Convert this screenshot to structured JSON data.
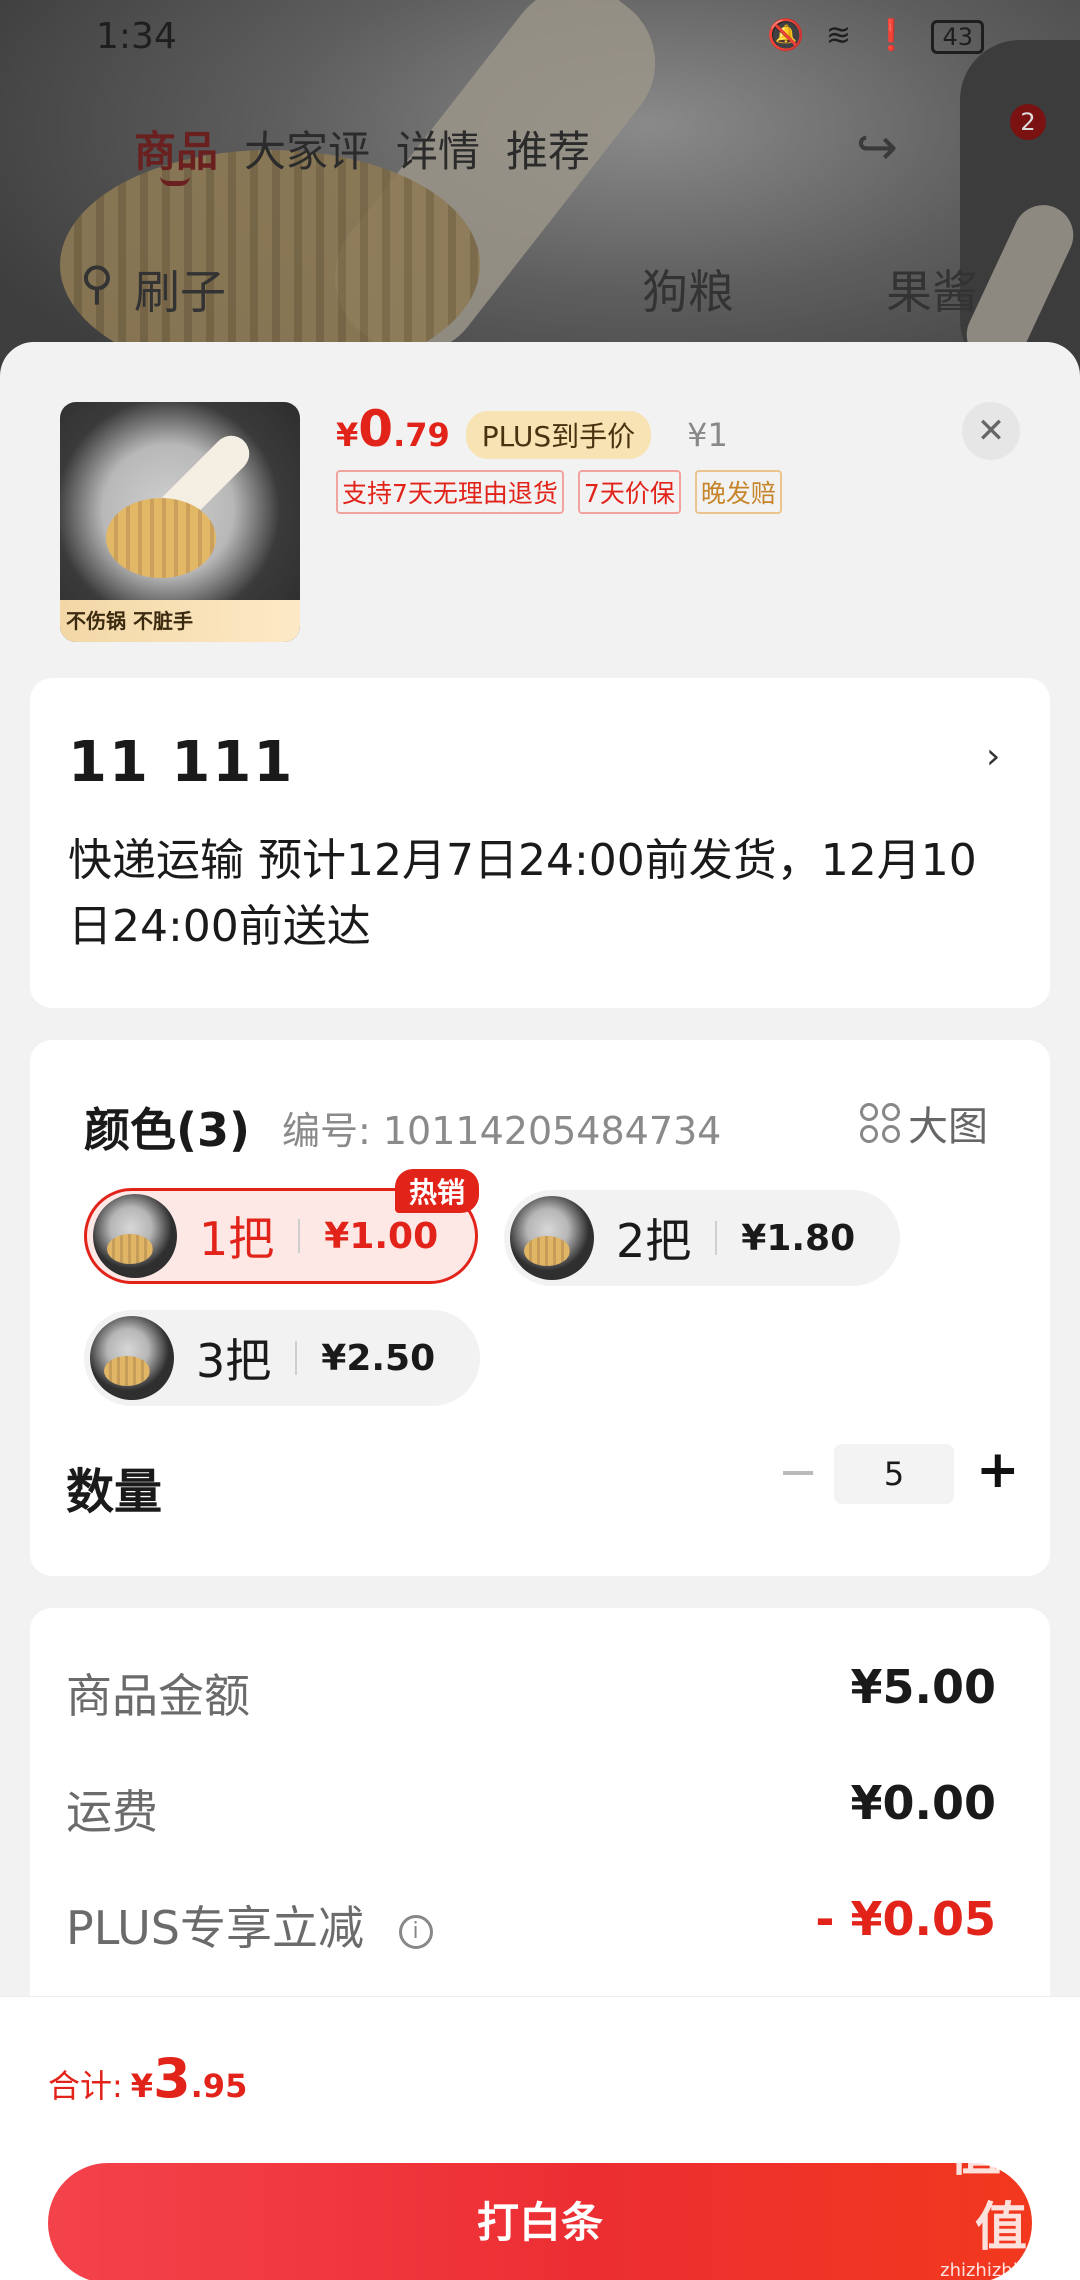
{
  "status_bar": {
    "time": "1:34",
    "battery": "43"
  },
  "background": {
    "tabs": [
      "商品",
      "大家评",
      "详情",
      "推荐"
    ],
    "active_tab": 0,
    "cart_count": "2",
    "search_text": "刷子",
    "suggest1": "狗粮",
    "suggest2": "果酱"
  },
  "product": {
    "image_caption": "不伤锅 不脏手",
    "price_symbol": "¥",
    "price_int": "0",
    "price_dec": ".79",
    "plus_tag": "PLUS到手价",
    "original_price": "¥1",
    "promo_tags": [
      "支持7天无理由退货",
      "7天价保",
      "晚发赔"
    ],
    "close_icon": "close-icon"
  },
  "address": {
    "name": "11  111",
    "shipping": "快递运输 预计12月7日24:00前发货，12月10日24:00前送达"
  },
  "spec": {
    "title": "颜色(3)",
    "code": "编号: 10114205484734",
    "big_pic_label": "大图",
    "options": [
      {
        "label": "1把",
        "price": "¥1.00",
        "badge": "热销",
        "selected": true
      },
      {
        "label": "2把",
        "price": "¥1.80",
        "selected": false
      },
      {
        "label": "3把",
        "price": "¥2.50",
        "selected": false
      }
    ]
  },
  "quantity": {
    "label": "数量",
    "value": "5",
    "minus": "−",
    "plus": "+"
  },
  "summary": {
    "rows": [
      {
        "label": "商品金额",
        "value": "¥5.00"
      },
      {
        "label": "运费",
        "value": "¥0.00"
      },
      {
        "label": "PLUS专享立减",
        "value": "- ¥0.05"
      }
    ]
  },
  "footer": {
    "total_label": "合计:",
    "total_symbol": "¥",
    "total_int": "3",
    "total_dec": ".95",
    "pay_button": "打白条"
  },
  "watermark": {
    "big": "值值值",
    "small": "zhizhizhi.com"
  },
  "colors": {
    "accent": "#e2231a",
    "plus_gold": "#f7e3b4",
    "sheet_bg": "#f2f2f2"
  }
}
